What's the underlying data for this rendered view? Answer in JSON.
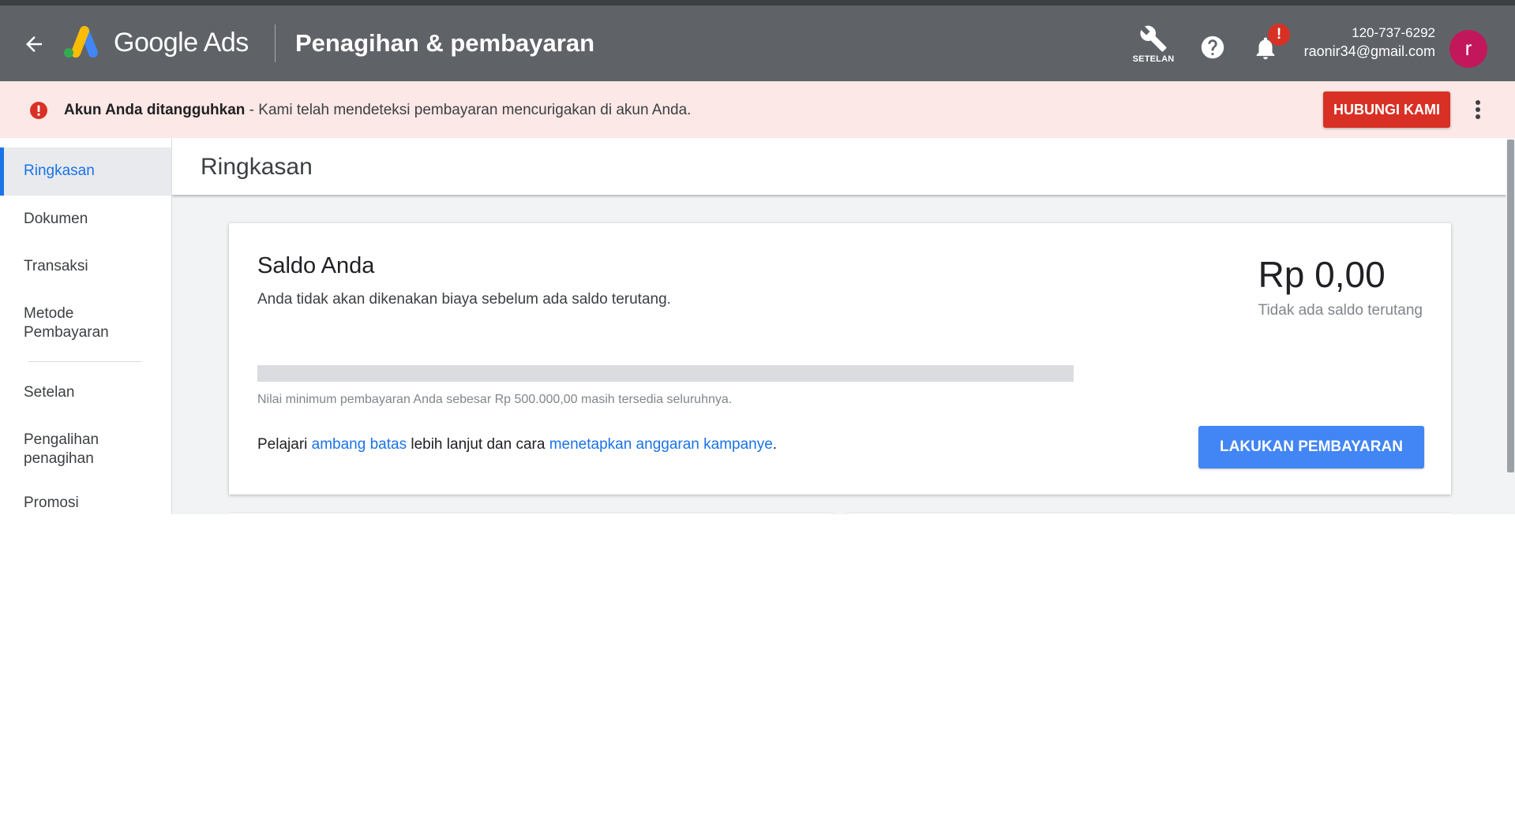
{
  "header": {
    "logo_text": "Google Ads",
    "page_title": "Penagihan & pembayaran",
    "settings_label": "SETELAN",
    "notification_badge": "!",
    "account_id": "120-737-6292",
    "account_email": "raonir34@gmail.com",
    "avatar_initial": "r"
  },
  "alert": {
    "title": "Akun Anda ditangguhkan",
    "message": " - Kami telah mendeteksi pembayaran mencurigakan di akun Anda.",
    "button_label": "HUBUNGI KAMI"
  },
  "sidebar": {
    "items": [
      {
        "label": "Ringkasan",
        "active": true
      },
      {
        "label": "Dokumen"
      },
      {
        "label": "Transaksi"
      },
      {
        "label": "Metode Pembayaran"
      },
      {
        "label": "Setelan"
      },
      {
        "label": "Pengalihan penagihan"
      },
      {
        "label": "Promosi"
      }
    ]
  },
  "main": {
    "title": "Ringkasan",
    "card": {
      "title": "Saldo Anda",
      "subtitle": "Anda tidak akan dikenakan biaya sebelum ada saldo terutang.",
      "amount": "Rp 0,00",
      "amount_note": "Tidak ada saldo terutang",
      "progress_fraction": 0,
      "progress_note": "Nilai minimum pembayaran Anda sebesar Rp 500.000,00 masih tersedia seluruhnya.",
      "learn_prefix": "Pelajari ",
      "learn_link1": "ambang batas",
      "learn_middle": " lebih lanjut dan cara ",
      "learn_link2": "menetapkan anggaran kampanye",
      "learn_suffix": ".",
      "pay_button": "LAKUKAN PEMBAYARAN"
    }
  },
  "colors": {
    "header_bg": "#5f6368",
    "alert_bg": "#fce8e6",
    "danger": "#d93025",
    "primary": "#4285f4",
    "link": "#1a73e8",
    "avatar": "#c2185b"
  },
  "icons": {
    "back": "arrow-back-icon",
    "settings": "wrench-icon",
    "help": "help-circle-icon",
    "notifications": "bell-icon",
    "alert": "error-circle-icon",
    "more": "more-vert-icon"
  }
}
